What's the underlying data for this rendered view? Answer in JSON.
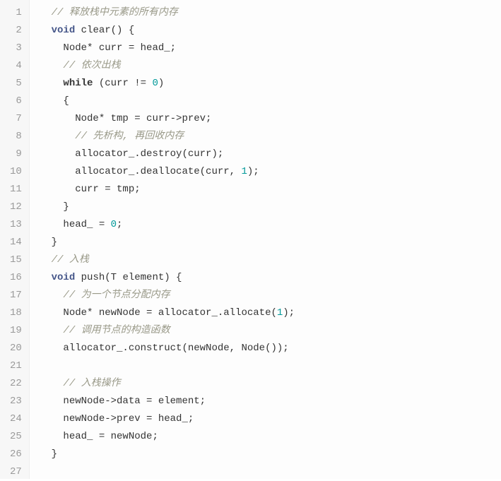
{
  "chart_data": {
    "type": "table",
    "title": "C++ code listing",
    "lines": [
      {
        "n": 1,
        "tokens": [
          {
            "t": "  ",
            "c": ""
          },
          {
            "t": "// 释放栈中元素的所有内存",
            "c": "c"
          }
        ]
      },
      {
        "n": 2,
        "tokens": [
          {
            "t": "  ",
            "c": ""
          },
          {
            "t": "void",
            "c": "t"
          },
          {
            "t": " clear() {",
            "c": ""
          }
        ]
      },
      {
        "n": 3,
        "tokens": [
          {
            "t": "    Node* curr = head_;",
            "c": ""
          }
        ]
      },
      {
        "n": 4,
        "tokens": [
          {
            "t": "    ",
            "c": ""
          },
          {
            "t": "// 依次出栈",
            "c": "c"
          }
        ]
      },
      {
        "n": 5,
        "tokens": [
          {
            "t": "    ",
            "c": ""
          },
          {
            "t": "while",
            "c": "k"
          },
          {
            "t": " (curr != ",
            "c": ""
          },
          {
            "t": "0",
            "c": "n"
          },
          {
            "t": ")",
            "c": ""
          }
        ]
      },
      {
        "n": 6,
        "tokens": [
          {
            "t": "    {",
            "c": ""
          }
        ]
      },
      {
        "n": 7,
        "tokens": [
          {
            "t": "      Node* tmp = curr->prev;",
            "c": ""
          }
        ]
      },
      {
        "n": 8,
        "tokens": [
          {
            "t": "      ",
            "c": ""
          },
          {
            "t": "// 先析构, 再回收内存",
            "c": "c"
          }
        ]
      },
      {
        "n": 9,
        "tokens": [
          {
            "t": "      allocator_.destroy(curr);",
            "c": ""
          }
        ]
      },
      {
        "n": 10,
        "tokens": [
          {
            "t": "      allocator_.deallocate(curr, ",
            "c": ""
          },
          {
            "t": "1",
            "c": "n"
          },
          {
            "t": ");",
            "c": ""
          }
        ]
      },
      {
        "n": 11,
        "tokens": [
          {
            "t": "      curr = tmp;",
            "c": ""
          }
        ]
      },
      {
        "n": 12,
        "tokens": [
          {
            "t": "    }",
            "c": ""
          }
        ]
      },
      {
        "n": 13,
        "tokens": [
          {
            "t": "    head_ = ",
            "c": ""
          },
          {
            "t": "0",
            "c": "n"
          },
          {
            "t": ";",
            "c": ""
          }
        ]
      },
      {
        "n": 14,
        "tokens": [
          {
            "t": "  }",
            "c": ""
          }
        ]
      },
      {
        "n": 15,
        "tokens": [
          {
            "t": "  ",
            "c": ""
          },
          {
            "t": "// 入栈",
            "c": "c"
          }
        ]
      },
      {
        "n": 16,
        "tokens": [
          {
            "t": "  ",
            "c": ""
          },
          {
            "t": "void",
            "c": "t"
          },
          {
            "t": " push(T element) {",
            "c": ""
          }
        ]
      },
      {
        "n": 17,
        "tokens": [
          {
            "t": "    ",
            "c": ""
          },
          {
            "t": "// 为一个节点分配内存",
            "c": "c"
          }
        ]
      },
      {
        "n": 18,
        "tokens": [
          {
            "t": "    Node* newNode = allocator_.allocate(",
            "c": ""
          },
          {
            "t": "1",
            "c": "n"
          },
          {
            "t": ");",
            "c": ""
          }
        ]
      },
      {
        "n": 19,
        "tokens": [
          {
            "t": "    ",
            "c": ""
          },
          {
            "t": "// 调用节点的构造函数",
            "c": "c"
          }
        ]
      },
      {
        "n": 20,
        "tokens": [
          {
            "t": "    allocator_.construct(newNode, Node());",
            "c": ""
          }
        ]
      },
      {
        "n": 21,
        "tokens": [
          {
            "t": "",
            "c": ""
          }
        ]
      },
      {
        "n": 22,
        "tokens": [
          {
            "t": "    ",
            "c": ""
          },
          {
            "t": "// 入栈操作",
            "c": "c"
          }
        ]
      },
      {
        "n": 23,
        "tokens": [
          {
            "t": "    newNode->data = element;",
            "c": ""
          }
        ]
      },
      {
        "n": 24,
        "tokens": [
          {
            "t": "    newNode->prev = head_;",
            "c": ""
          }
        ]
      },
      {
        "n": 25,
        "tokens": [
          {
            "t": "    head_ = newNode;",
            "c": ""
          }
        ]
      },
      {
        "n": 26,
        "tokens": [
          {
            "t": "  }",
            "c": ""
          }
        ]
      },
      {
        "n": 27,
        "tokens": [
          {
            "t": "",
            "c": ""
          }
        ]
      }
    ]
  }
}
